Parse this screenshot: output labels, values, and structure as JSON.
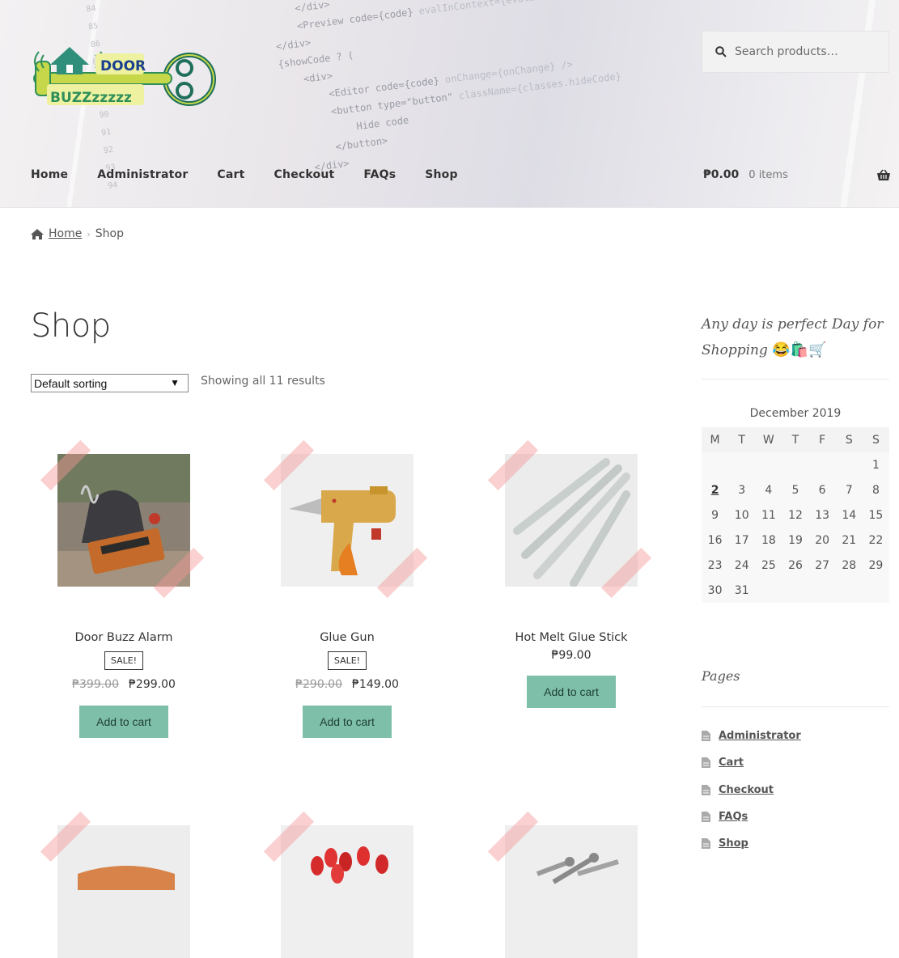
{
  "header": {
    "logo": {
      "line1": "DOOR",
      "line2": "BUZZzzzzz"
    },
    "search_placeholder": "Search products…",
    "nav": [
      "Home",
      "Administrator",
      "Cart",
      "Checkout",
      "FAQs",
      "Shop"
    ],
    "cart": {
      "amount": "₱0.00",
      "count": "0 items"
    }
  },
  "breadcrumb": {
    "home": "Home",
    "current": "Shop"
  },
  "main": {
    "title": "Shop",
    "sorting": "Default sorting",
    "result_count": "Showing all 11 results",
    "products": [
      {
        "name": "Door Buzz Alarm",
        "badge": "SALE!",
        "old_price": "₱399.00",
        "price": "₱299.00",
        "button": "Add to cart"
      },
      {
        "name": "Glue Gun",
        "badge": "SALE!",
        "old_price": "₱290.00",
        "price": "₱149.00",
        "button": "Add to cart"
      },
      {
        "name": "Hot Melt Glue Stick",
        "price": "₱99.00",
        "button": "Add to cart"
      }
    ]
  },
  "sidebar": {
    "tagline": "Any day is perfect Day for Shopping",
    "tagline_emojis": "😂🛍️🛒",
    "calendar": {
      "caption": "December 2019",
      "days": [
        "M",
        "T",
        "W",
        "T",
        "F",
        "S",
        "S"
      ],
      "weeks": [
        [
          "",
          "",
          "",
          "",
          "",
          "",
          "1"
        ],
        [
          "2",
          "3",
          "4",
          "5",
          "6",
          "7",
          "8"
        ],
        [
          "9",
          "10",
          "11",
          "12",
          "13",
          "14",
          "15"
        ],
        [
          "16",
          "17",
          "18",
          "19",
          "20",
          "21",
          "22"
        ],
        [
          "23",
          "24",
          "25",
          "26",
          "27",
          "28",
          "29"
        ],
        [
          "30",
          "31",
          "",
          "",
          "",
          "",
          ""
        ]
      ]
    },
    "pages_title": "Pages",
    "pages": [
      "Administrator",
      "Cart",
      "Checkout",
      "FAQs",
      "Shop"
    ]
  }
}
